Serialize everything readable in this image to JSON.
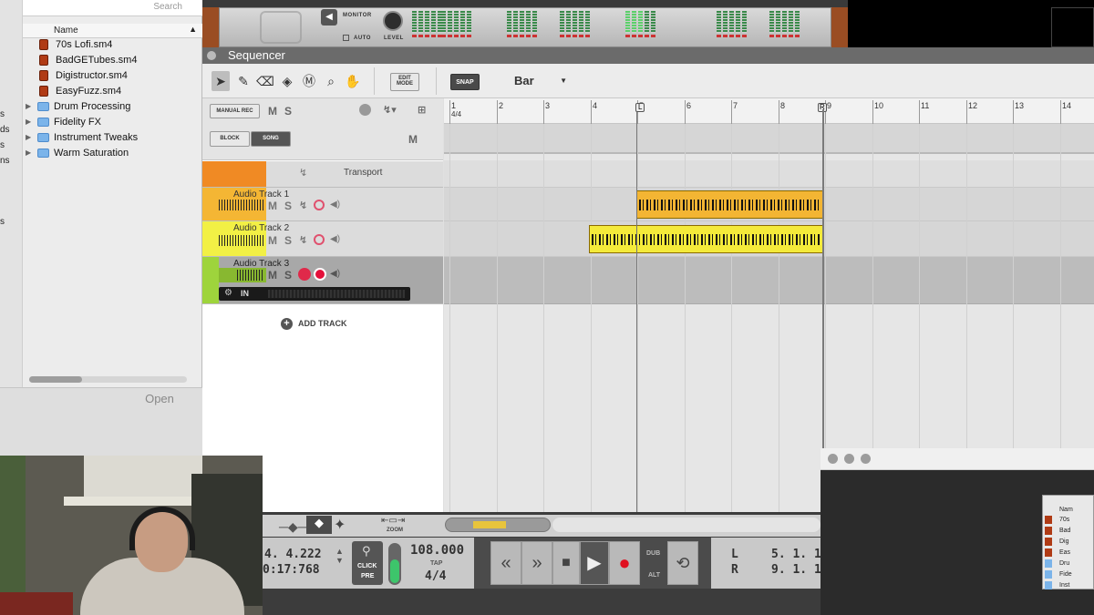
{
  "file_browser": {
    "search_placeholder": "Search",
    "column_name": "Name",
    "side_fragments": [
      "s",
      "ds",
      "s",
      "ns",
      "s"
    ],
    "files": [
      "70s Lofi.sm4",
      "BadGETubes.sm4",
      "Digistructor.sm4",
      "EasyFuzz.sm4"
    ],
    "folders": [
      "Drum Processing",
      "Fidelity FX",
      "Instrument Tweaks",
      "Warm Saturation"
    ],
    "open_label": "Open"
  },
  "rack": {
    "monitor_label": "MONITOR",
    "auto_label": "AUTO",
    "level_label": "LEVEL"
  },
  "sequencer": {
    "title": "Sequencer",
    "edit_mode_line1": "EDIT",
    "edit_mode_line2": "MODE",
    "snap_label": "SNAP",
    "snap_value": "Bar",
    "manual_rec": "MANUAL REC",
    "m": "M",
    "s": "S",
    "block": "BLOCK",
    "song": "SONG",
    "transport_track": "Transport",
    "tracks": [
      "Audio Track 1",
      "Audio Track 2",
      "Audio Track 3"
    ],
    "input_label": "IN",
    "add_track": "ADD TRACK",
    "time_sig": "4/4",
    "bars": [
      "1",
      "2",
      "3",
      "4",
      "5",
      "6",
      "7",
      "8",
      "9",
      "10",
      "11",
      "12",
      "13",
      "14"
    ],
    "loop_left": "L",
    "loop_right": "R"
  },
  "transport": {
    "zoom": "ZOOM",
    "position": "4. 4.222",
    "time": "0:17:768",
    "click": "CLICK",
    "pre": "PRE",
    "tempo": "108.000",
    "tap": "TAP",
    "signature": "4/4",
    "dub": "DUB",
    "alt": "ALT",
    "l_label": "L",
    "r_label": "R",
    "l_value": "5. 1. 1",
    "r_value": "9. 1. 1"
  },
  "mini_window": {
    "header": "Nam",
    "rows": [
      "70s",
      "Bad",
      "Dig",
      "Eas",
      "Dru",
      "Fide",
      "Inst"
    ]
  }
}
